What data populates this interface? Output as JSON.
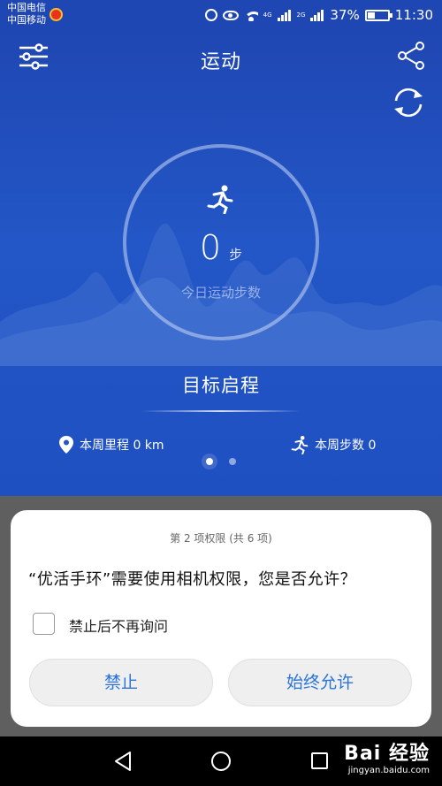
{
  "status_bar": {
    "carrier_1": "中国电信",
    "carrier_2": "中国移动",
    "network_1": "4G",
    "network_2": "2G",
    "battery": "37%",
    "time": "11:30"
  },
  "header": {
    "title": "运动"
  },
  "steps": {
    "value": "0",
    "unit": "步",
    "caption": "今日运动步数"
  },
  "goal": {
    "label": "目标启程"
  },
  "stats": {
    "weekly_distance": "本周里程 0 km",
    "weekly_steps": "本周步数 0"
  },
  "pager": {
    "pages": 2,
    "active": 0
  },
  "dialog": {
    "counter": "第 2 项权限 (共 6 项)",
    "message": "“优活手环”需要使用相机权限，您是否允许？",
    "checkbox_label": "禁止后不再询问",
    "checkbox_checked": false,
    "deny_label": "禁止",
    "allow_label": "始终允许"
  },
  "watermark": {
    "logo": "Bai 经验",
    "url": "jingyan.baidu.com"
  },
  "colors": {
    "app_blue": "#1f47b3",
    "button_text": "#2a74d8"
  }
}
